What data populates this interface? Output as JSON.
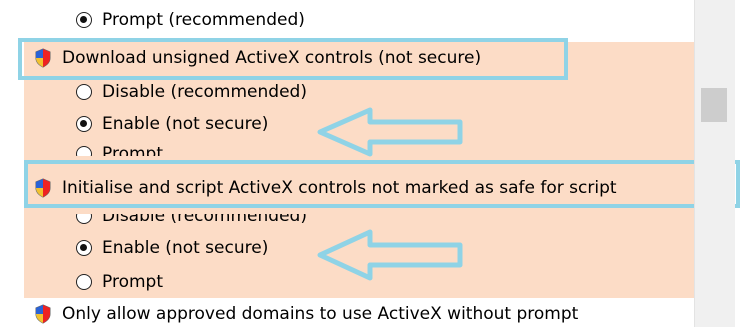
{
  "settings": {
    "prompt_recommended": "Prompt (recommended)",
    "download_unsigned_title": "Download unsigned ActiveX controls (not secure)",
    "download_disable": "Disable (recommended)",
    "download_enable": "Enable (not secure)",
    "download_prompt": "Prompt",
    "initialise_title": "Initialise and script ActiveX controls not marked as safe for script",
    "initialise_disable": "Disable (recommended)",
    "initialise_enable": "Enable (not secure)",
    "initialise_prompt": "Prompt",
    "approved_domains_title": "Only allow approved domains to use ActiveX without prompt"
  },
  "colors": {
    "highlight_band": "#fcdcc6",
    "callout_outline": "#8fd3e6",
    "selected_radio": "#111111"
  },
  "icons": {
    "setting_icon": "shield-icon",
    "annotation_arrow": "left-arrow-icon"
  }
}
